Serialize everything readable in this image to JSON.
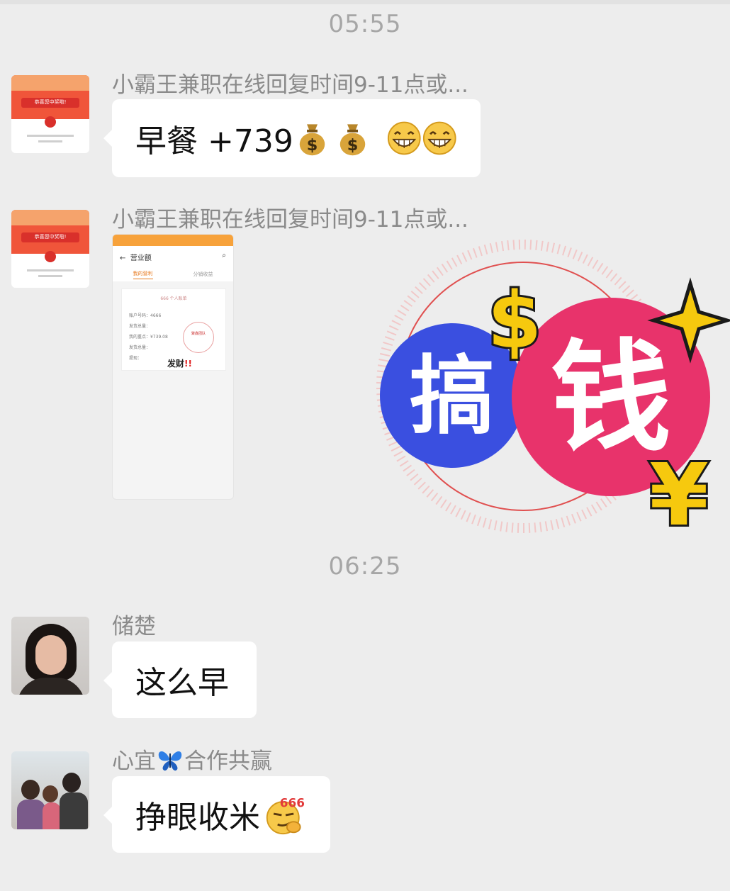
{
  "chat": {
    "time1": "05:55",
    "time2": "06:25",
    "messages": [
      {
        "sender": "小霸王兼职在线回复时间9-11点或...",
        "text": "早餐 +739",
        "emojis": [
          "money-bag",
          "money-bag",
          "grin",
          "grin"
        ]
      },
      {
        "sender": "小霸王兼职在线回复时间9-11点或...",
        "image": {
          "header_title": "营业额",
          "tab_active": "我的营利",
          "tab_other": "分销收益",
          "card_title": "666 个人账单",
          "rows": [
            "账户号码：4666",
            "发货总量：",
            "我的重点：¥739.08",
            "发货总量：",
            "提现："
          ],
          "stamp_text": "聚鑫团队",
          "caption": "发财",
          "caption_marks": "!!"
        },
        "sticker": {
          "left_char": "搞",
          "right_char": "钱",
          "colors": {
            "blue": "#3a4fe0",
            "pink": "#e8336b",
            "gold": "#f6c90e"
          }
        }
      },
      {
        "sender": "储楚",
        "text": "这么早"
      },
      {
        "sender_parts": [
          "心宜",
          "合作共赢"
        ],
        "sender_icon": "butterfly",
        "text": "挣眼收米",
        "emoji_badge": "666"
      }
    ]
  },
  "red_packet_avatar": {
    "banner": "恭喜您中奖啦!"
  }
}
